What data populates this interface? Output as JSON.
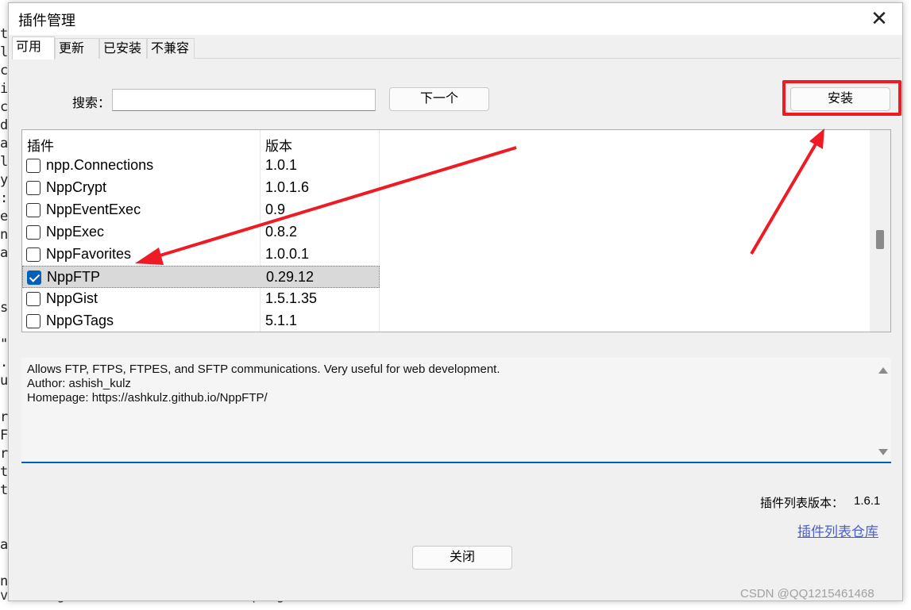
{
  "background_editor": {
    "lines": [
      "t",
      "l",
      "c",
      "i",
      "c",
      "d",
      "a",
      "l",
      "y",
      ":",
      "e",
      "n",
      "a",
      "",
      "s",
      "",
      "\"",
      ".",
      "u",
      "",
      "r",
      "F",
      "r",
      "t",
      "t",
      "",
      "",
      "a",
      "",
      "n"
    ],
    "bottom_line": "visual glitch of find in files progress window & Document Switcher."
  },
  "dialog": {
    "title": "插件管理",
    "close_glyph": "✕",
    "tabs": [
      {
        "label": "可用",
        "active": true
      },
      {
        "label": "更新",
        "active": false
      },
      {
        "label": "已安装",
        "active": false
      },
      {
        "label": "不兼容",
        "active": false
      }
    ],
    "search": {
      "label": "搜索：",
      "value": ""
    },
    "next_button": "下一个",
    "install_button": "安装",
    "list": {
      "headers": {
        "name": "插件",
        "version": "版本"
      },
      "rows": [
        {
          "name": "npp.Connections",
          "version": "1.0.1",
          "checked": false
        },
        {
          "name": "NppCrypt",
          "version": "1.0.1.6",
          "checked": false
        },
        {
          "name": "NppEventExec",
          "version": "0.9",
          "checked": false
        },
        {
          "name": "NppExec",
          "version": "0.8.2",
          "checked": false
        },
        {
          "name": "NppFavorites",
          "version": "1.0.0.1",
          "checked": false
        },
        {
          "name": "NppFTP",
          "version": "0.29.12",
          "checked": true
        },
        {
          "name": "NppGist",
          "version": "1.5.1.35",
          "checked": false
        },
        {
          "name": "NppGTags",
          "version": "5.1.1",
          "checked": false
        }
      ]
    },
    "description": {
      "lines": [
        "Allows FTP, FTPS, FTPES, and SFTP communications. Very useful for web development.",
        "Author: ashish_kulz",
        "Homepage: https://ashkulz.github.io/NppFTP/"
      ]
    },
    "list_version_label": "插件列表版本：",
    "list_version_value": "1.6.1",
    "repo_link": "插件列表仓库",
    "close_button": "关闭"
  },
  "annotations": {
    "color": "#ee1b24"
  },
  "watermark": "CSDN @QQ1215461468"
}
